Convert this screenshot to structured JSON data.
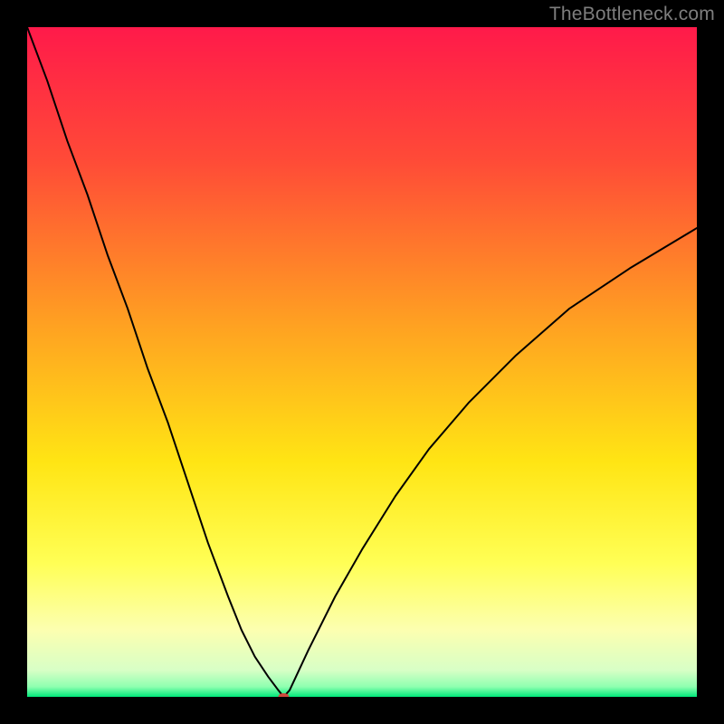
{
  "watermark": "TheBottleneck.com",
  "chart_data": {
    "type": "line",
    "title": "",
    "xlabel": "",
    "ylabel": "",
    "xlim": [
      0,
      100
    ],
    "ylim": [
      0,
      100
    ],
    "grid": false,
    "legend": false,
    "background_gradient": {
      "direction": "vertical",
      "stops": [
        {
          "pos": 0.0,
          "color": "#ff1a4a"
        },
        {
          "pos": 0.2,
          "color": "#ff4b37"
        },
        {
          "pos": 0.45,
          "color": "#ffa321"
        },
        {
          "pos": 0.65,
          "color": "#ffe514"
        },
        {
          "pos": 0.8,
          "color": "#ffff55"
        },
        {
          "pos": 0.9,
          "color": "#fcffb0"
        },
        {
          "pos": 0.96,
          "color": "#d8ffc6"
        },
        {
          "pos": 0.985,
          "color": "#8effb0"
        },
        {
          "pos": 1.0,
          "color": "#00e87a"
        }
      ]
    },
    "series": [
      {
        "name": "curve",
        "stroke": "#000000",
        "stroke_width": 2,
        "x": [
          0,
          3,
          6,
          9,
          12,
          15,
          18,
          21,
          24,
          27,
          30,
          32,
          34,
          36,
          37.5,
          38.3,
          39.2,
          42,
          46,
          50,
          55,
          60,
          66,
          73,
          81,
          90,
          100
        ],
        "y": [
          100,
          92,
          83,
          75,
          66,
          58,
          49,
          41,
          32,
          23,
          15,
          10,
          6,
          3,
          1,
          0,
          1,
          7,
          15,
          22,
          30,
          37,
          44,
          51,
          58,
          64,
          70
        ]
      }
    ],
    "marker": {
      "x": 38.3,
      "y": 0,
      "color": "#d04a3e",
      "rx": 6,
      "ry": 4
    }
  }
}
